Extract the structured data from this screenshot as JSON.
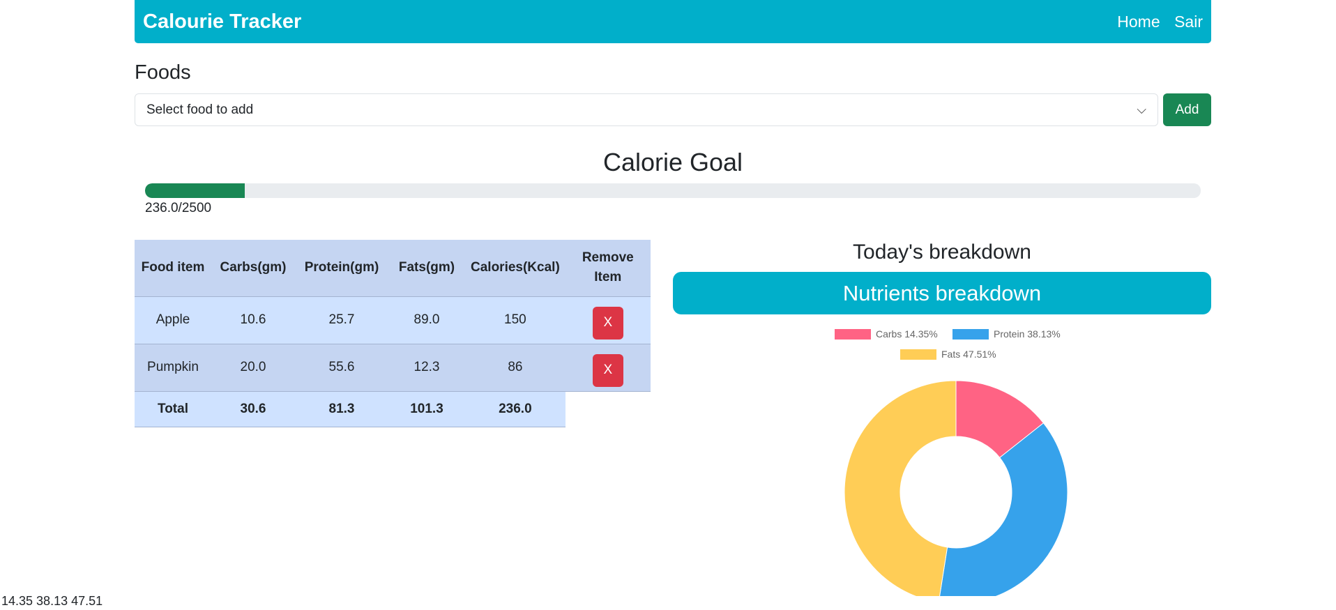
{
  "navbar": {
    "brand": "Calourie Tracker",
    "links": [
      "Home",
      "Sair"
    ]
  },
  "foods": {
    "heading": "Foods",
    "select_placeholder": "Select food to add",
    "add_label": "Add"
  },
  "goal": {
    "heading": "Calorie Goal",
    "current": 236.0,
    "target": 2500,
    "label": "236.0/2500",
    "progress_percent": 9.44
  },
  "table": {
    "headers": [
      "Food item",
      "Carbs(gm)",
      "Protein(gm)",
      "Fats(gm)",
      "Calories(Kcal)",
      "Remove Item"
    ],
    "rows": [
      [
        "Apple",
        "10.6",
        "25.7",
        "89.0",
        "150"
      ],
      [
        "Pumpkin",
        "20.0",
        "55.6",
        "12.3",
        "86"
      ]
    ],
    "remove_label": "X",
    "total": [
      "Total",
      "30.6",
      "81.3",
      "101.3",
      "236.0"
    ]
  },
  "breakdown": {
    "heading": "Today's breakdown",
    "banner": "Nutrients breakdown"
  },
  "chart_data": {
    "type": "doughnut",
    "title": "",
    "categories": [
      "Carbs",
      "Protein",
      "Fats"
    ],
    "values": [
      14.35,
      38.13,
      47.51
    ],
    "legend_labels": [
      "Carbs 14.35%",
      "Protein 38.13%",
      "Fats 47.51%"
    ],
    "colors": [
      "#ff6384",
      "#36a2eb",
      "#ffcd56"
    ],
    "legend_position": "top"
  },
  "footer_text": "14.35 38.13 47.51"
}
